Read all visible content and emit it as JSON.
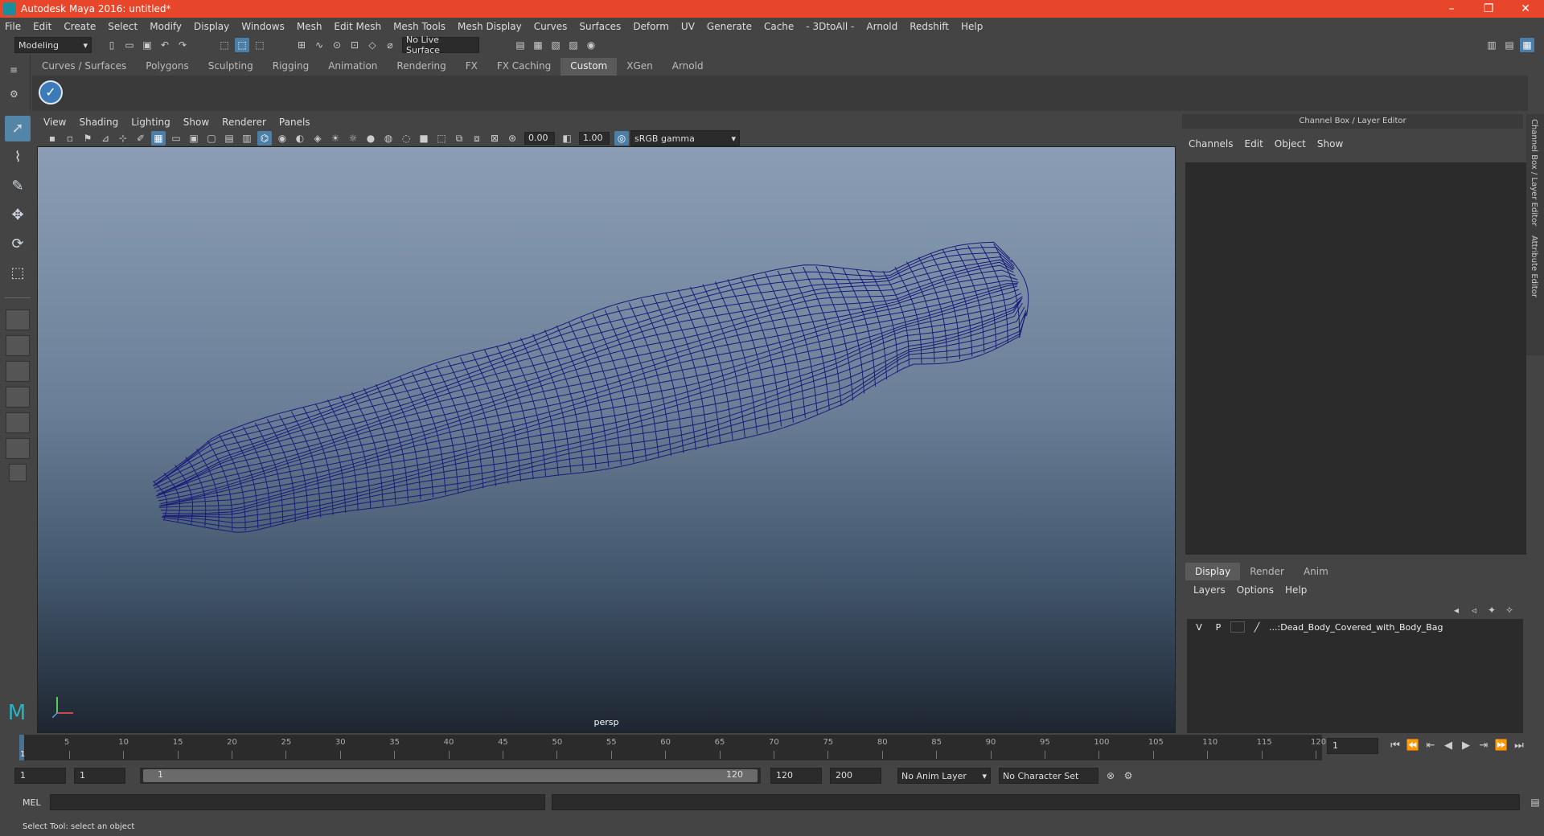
{
  "window": {
    "title": "Autodesk Maya 2016: untitled*"
  },
  "menubar": {
    "items": [
      "File",
      "Edit",
      "Create",
      "Select",
      "Modify",
      "Display",
      "Windows",
      "Mesh",
      "Edit Mesh",
      "Mesh Tools",
      "Mesh Display",
      "Curves",
      "Surfaces",
      "Deform",
      "UV",
      "Generate",
      "Cache",
      "- 3DtoAll -",
      "Arnold",
      "Redshift",
      "Help"
    ]
  },
  "statusline": {
    "mode": "Modeling",
    "live_surface": "No Live Surface"
  },
  "shelf": {
    "tabs": [
      "Curves / Surfaces",
      "Polygons",
      "Sculpting",
      "Rigging",
      "Animation",
      "Rendering",
      "FX",
      "FX Caching",
      "Custom",
      "XGen",
      "Arnold"
    ],
    "active": "Custom"
  },
  "viewport": {
    "menu": [
      "View",
      "Shading",
      "Lighting",
      "Show",
      "Renderer",
      "Panels"
    ],
    "exposure": "0.00",
    "gamma": "1.00",
    "color_space": "sRGB gamma",
    "camera_label": "persp",
    "colors": {
      "wireframe": "#1a1a7a"
    }
  },
  "channelbox": {
    "header": "Channel Box / Layer Editor",
    "menu": [
      "Channels",
      "Edit",
      "Object",
      "Show"
    ],
    "layer_tabs": [
      "Display",
      "Render",
      "Anim"
    ],
    "layer_menu": [
      "Layers",
      "Options",
      "Help"
    ],
    "layer": {
      "v": "V",
      "p": "P",
      "name": "...:Dead_Body_Covered_with_Body_Bag"
    },
    "side_tabs": [
      "Channel Box / Layer Editor",
      "Attribute Editor"
    ]
  },
  "timeslider": {
    "ticks": [
      "5",
      "10",
      "15",
      "20",
      "25",
      "30",
      "35",
      "40",
      "45",
      "50",
      "55",
      "60",
      "65",
      "70",
      "75",
      "80",
      "85",
      "90",
      "95",
      "100",
      "105",
      "110",
      "115",
      "120"
    ],
    "current_marker": "1",
    "current_frame": "1"
  },
  "range": {
    "start": "1",
    "playback_start": "1",
    "range_start_label": "1",
    "range_end_label": "120",
    "playback_end": "120",
    "end": "200",
    "anim_layer": "No Anim Layer",
    "character_set": "No Character Set"
  },
  "cmdline": {
    "label": "MEL"
  },
  "helpline": {
    "text": "Select Tool: select an object"
  }
}
